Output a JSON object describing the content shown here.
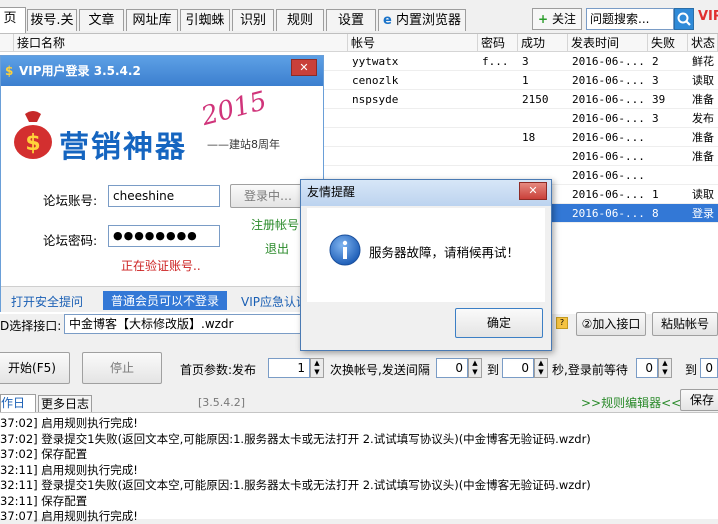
{
  "tabs": [
    "页",
    "拨号.关",
    "文章",
    "网址库",
    "引蜘蛛",
    "识别",
    "规则",
    "设置",
    "内置浏览器"
  ],
  "toolbar": {
    "follow": "关注",
    "search_placeholder": "问题搜索...",
    "vip": "VIP"
  },
  "table": {
    "headers": [
      "",
      "接口名称",
      "帐号",
      "密码",
      "成功",
      "发表时间",
      "失败",
      "状态"
    ],
    "rows": [
      {
        "account": "yytwatx",
        "password": "f...",
        "success": "3",
        "time": "2016-06-...",
        "fail": "2",
        "status": "鲜花"
      },
      {
        "account": "cenozlk",
        "password": "",
        "success": "1",
        "time": "2016-06-...",
        "fail": "3",
        "status": "读取"
      },
      {
        "account": "nspsyde",
        "password": "",
        "success": "2150",
        "time": "2016-06-...",
        "fail": "39",
        "status": "准备"
      },
      {
        "account": "",
        "password": "",
        "success": "",
        "time": "2016-06-...",
        "fail": "3",
        "status": "发布"
      },
      {
        "account": "",
        "password": "",
        "success": "18",
        "time": "2016-06-...",
        "fail": "",
        "status": "准备"
      },
      {
        "account": "",
        "password": "",
        "success": "",
        "time": "2016-06-...",
        "fail": "",
        "status": "准备"
      },
      {
        "account": "",
        "password": "",
        "success": "",
        "time": "2016-06-...",
        "fail": "",
        "status": ""
      },
      {
        "account": "",
        "password": "",
        "success": "",
        "time": "2016-06-...",
        "fail": "1",
        "status": "读取"
      },
      {
        "account": "",
        "password": "",
        "success": "",
        "time": "2016-06-...",
        "fail": "8",
        "status": "登录",
        "selected": true
      }
    ]
  },
  "vip": {
    "title": "VIP用户登录 3.5.4.2",
    "brand": "营销神器",
    "year": "2015",
    "tagline": "——建站8周年",
    "account_label": "论坛账号:",
    "account_value": "cheeshine",
    "password_label": "论坛密码:",
    "password_value": "●●●●●●●●",
    "login_button": "登录中…",
    "register": "注册帐号",
    "exit": "退出",
    "verifying": "正在验证账号..",
    "safe_prompt": "打开安全提问",
    "member_note": "普通会员可以不登录",
    "vip_cert": "VIP应急认证"
  },
  "dialog": {
    "title": "友情提醒",
    "message": "服务器故障，请稍候再试！",
    "ok": "确定"
  },
  "controls": {
    "select_label": "D选择接口:",
    "select_value": "中金博客【大标修改版】.wzdr",
    "add_interface": "②加入接口",
    "paste_account": "粘贴帐号",
    "start": "开始(F5)",
    "stop": "停止",
    "params_label": "首页参数:发布",
    "params_value": "1",
    "switch_text": "次换帐号,发送间隔",
    "interval_from": "0",
    "to": "到",
    "interval_to": "0",
    "wait_text": "秒,登录前等待",
    "wait_from": "0",
    "to2": "到",
    "wait_to": "0"
  },
  "log": {
    "tabs": [
      "作日志",
      "更多日志"
    ],
    "version": "[3.5.4.2]",
    "rule_editor": ">>规则编辑器<<",
    "save_button": "保存",
    "lines": [
      "37:02] 启用规则执行完成!",
      "37:02] 登录提交1失败(返回文本空,可能原因:1.服务器太卡或无法打开 2.试试填写协议头)(中金博客无验证码.wzdr)",
      "37:02] 保存配置",
      "32:11] 启用规则执行完成!",
      "32:11] 登录提交1失败(返回文本空,可能原因:1.服务器太卡或无法打开 2.试试填写协议头)(中金博客无验证码.wzdr)",
      "32:11] 保存配置",
      "37:07] 启用规则执行完成!"
    ]
  },
  "colors": {
    "accent": "#3378d6",
    "title_bar": "#3c7fcf",
    "error_text": "#cc2222",
    "green_link": "#2a8a2a"
  }
}
